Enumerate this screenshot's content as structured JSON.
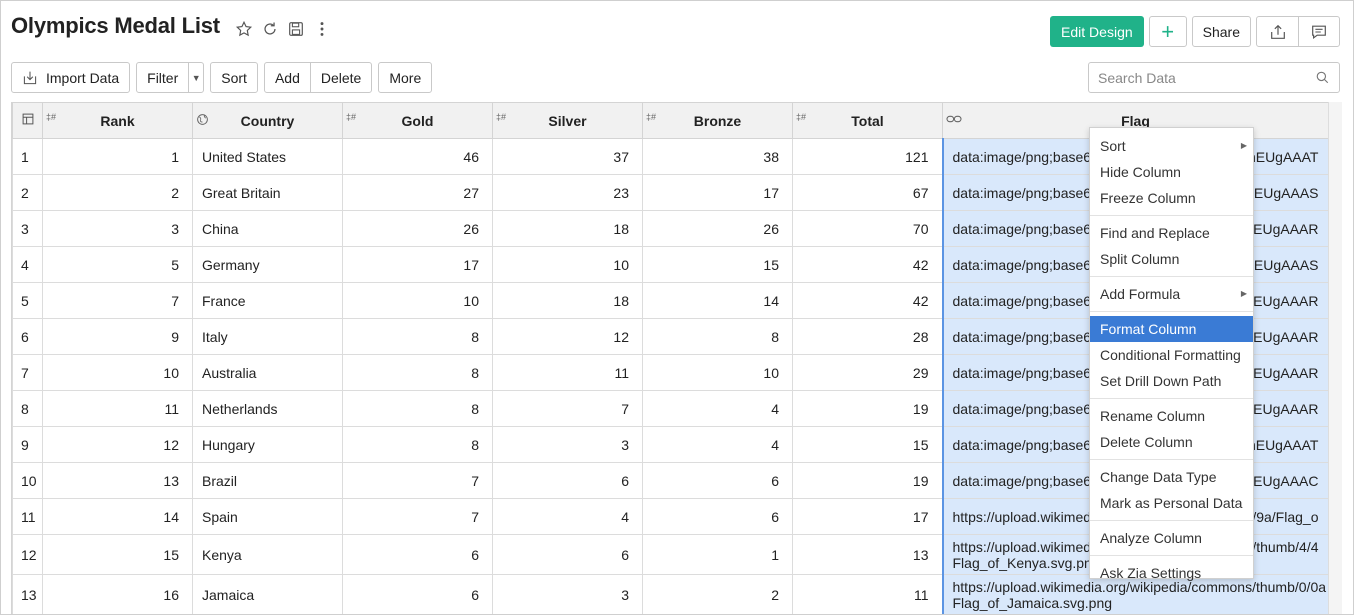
{
  "app": {
    "title": "Olympics Medal List"
  },
  "header": {
    "edit_design": "Edit Design",
    "add": "+",
    "share": "Share"
  },
  "toolbar": {
    "import_data": "Import Data",
    "filter": "Filter",
    "sort": "Sort",
    "add": "Add",
    "delete": "Delete",
    "more": "More"
  },
  "search": {
    "placeholder": "Search Data"
  },
  "columns": [
    {
      "label": "Rank",
      "type_marker": "‡#"
    },
    {
      "label": "Country",
      "type_marker": "globe"
    },
    {
      "label": "Gold",
      "type_marker": "‡#"
    },
    {
      "label": "Silver",
      "type_marker": "‡#"
    },
    {
      "label": "Bronze",
      "type_marker": "‡#"
    },
    {
      "label": "Total",
      "type_marker": "‡#"
    },
    {
      "label": "Flag",
      "type_marker": "link"
    }
  ],
  "rows": [
    {
      "n": "1",
      "rank": "1",
      "country": "United States",
      "gold": "46",
      "silver": "37",
      "bronze": "38",
      "total": "121",
      "flag_a": "data:image/png;base64",
      "flag_b": "UhEUgAAAT"
    },
    {
      "n": "2",
      "rank": "2",
      "country": "Great Britain",
      "gold": "27",
      "silver": "23",
      "bronze": "17",
      "total": "67",
      "flag_a": "data:image/png;base64",
      "flag_b": "UhEUgAAAS"
    },
    {
      "n": "3",
      "rank": "3",
      "country": "China",
      "gold": "26",
      "silver": "18",
      "bronze": "26",
      "total": "70",
      "flag_a": "data:image/png;base64",
      "flag_b": "UhEUgAAAR"
    },
    {
      "n": "4",
      "rank": "5",
      "country": "Germany",
      "gold": "17",
      "silver": "10",
      "bronze": "15",
      "total": "42",
      "flag_a": "data:image/png;base64",
      "flag_b": "UhEUgAAAS"
    },
    {
      "n": "5",
      "rank": "7",
      "country": "France",
      "gold": "10",
      "silver": "18",
      "bronze": "14",
      "total": "42",
      "flag_a": "data:image/png;base64",
      "flag_b": "UhEUgAAAR"
    },
    {
      "n": "6",
      "rank": "9",
      "country": "Italy",
      "gold": "8",
      "silver": "12",
      "bronze": "8",
      "total": "28",
      "flag_a": "data:image/png;base64",
      "flag_b": "UhEUgAAAR"
    },
    {
      "n": "7",
      "rank": "10",
      "country": "Australia",
      "gold": "8",
      "silver": "11",
      "bronze": "10",
      "total": "29",
      "flag_a": "data:image/png;base64",
      "flag_b": "UhEUgAAAR"
    },
    {
      "n": "8",
      "rank": "11",
      "country": "Netherlands",
      "gold": "8",
      "silver": "7",
      "bronze": "4",
      "total": "19",
      "flag_a": "data:image/png;base64",
      "flag_b": "UhEUgAAAR"
    },
    {
      "n": "9",
      "rank": "12",
      "country": "Hungary",
      "gold": "8",
      "silver": "3",
      "bronze": "4",
      "total": "15",
      "flag_a": "data:image/png;base64",
      "flag_b": "UhEUgAAAT"
    },
    {
      "n": "10",
      "rank": "13",
      "country": "Brazil",
      "gold": "7",
      "silver": "6",
      "bronze": "6",
      "total": "19",
      "flag_a": "data:image/png;base64",
      "flag_b": "UhEUgAAAC"
    },
    {
      "n": "11",
      "rank": "14",
      "country": "Spain",
      "gold": "7",
      "silver": "4",
      "bronze": "6",
      "total": "17",
      "flag_a": "https://upload.wikimed",
      "flag_b": "/9/9a/Flag_o"
    },
    {
      "n": "12",
      "rank": "15",
      "country": "Kenya",
      "gold": "6",
      "silver": "6",
      "bronze": "1",
      "total": "13",
      "flag_a": "https://upload.wikimed",
      "flag_b": "/thumb/4/4",
      "flag_c": "Flag_of_Kenya.svg.png"
    },
    {
      "n": "13",
      "rank": "16",
      "country": "Jamaica",
      "gold": "6",
      "silver": "3",
      "bronze": "2",
      "total": "11",
      "flag_a": "https://upload.wikimedia.org/wikipedia/commons/thumb/0/0a",
      "flag_c": "Flag_of_Jamaica.svg.png"
    }
  ],
  "context_menu": {
    "groups": [
      [
        {
          "label": "Sort",
          "submenu": true
        },
        {
          "label": "Hide Column"
        },
        {
          "label": "Freeze Column"
        }
      ],
      [
        {
          "label": "Find and Replace"
        },
        {
          "label": "Split Column"
        }
      ],
      [
        {
          "label": "Add Formula",
          "submenu": true
        }
      ],
      [
        {
          "label": "Format Column",
          "active": true
        },
        {
          "label": "Conditional Formatting"
        },
        {
          "label": "Set Drill Down Path"
        }
      ],
      [
        {
          "label": "Rename Column"
        },
        {
          "label": "Delete Column"
        }
      ],
      [
        {
          "label": "Change Data Type"
        },
        {
          "label": "Mark as Personal Data"
        }
      ],
      [
        {
          "label": "Analyze Column"
        }
      ],
      [
        {
          "label": "Ask Zia Settings"
        }
      ]
    ]
  },
  "colors": {
    "accent": "#20b289",
    "selection_fill": "#d9e8fb",
    "selection_border": "#5b94e3",
    "menu_active": "#3a7bd5"
  }
}
